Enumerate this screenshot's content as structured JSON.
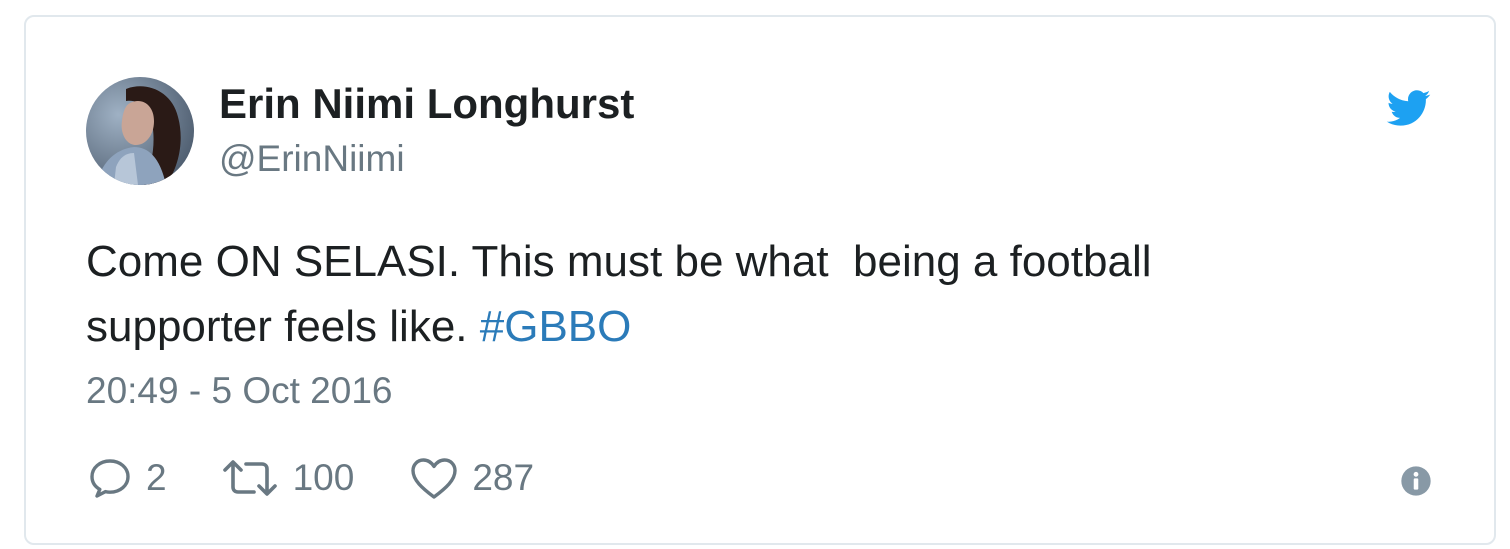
{
  "tweet": {
    "display_name": "Erin Niimi Longhurst",
    "handle": "@ErinNiimi",
    "text_line1": "Come ON SELASI. This must be what  being a football",
    "text_line2": "supporter feels like. ",
    "hashtag": "#GBBO",
    "timestamp": "20:49 - 5 Oct 2016"
  },
  "actions": {
    "reply_count": "2",
    "retweet_count": "100",
    "like_count": "287"
  },
  "icons": {
    "brand": "twitter-bird-icon",
    "reply": "reply-icon",
    "retweet": "retweet-icon",
    "like": "heart-icon",
    "info": "info-icon"
  },
  "colors": {
    "brand_blue": "#1da1f2",
    "hashtag_blue": "#2b7bb9",
    "muted_text": "#697882",
    "primary_text": "#1c2022",
    "border": "#e1e8ed"
  }
}
